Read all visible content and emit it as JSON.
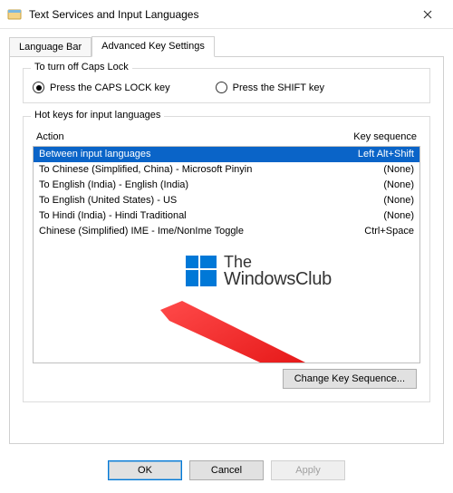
{
  "window": {
    "title": "Text Services and Input Languages"
  },
  "tabs": {
    "t0": "Language Bar",
    "t1": "Advanced Key Settings"
  },
  "capslock": {
    "group": "To turn off Caps Lock",
    "opt_caps": "Press the CAPS LOCK key",
    "opt_shift": "Press the SHIFT key"
  },
  "hotkeys": {
    "group": "Hot keys for input languages",
    "col_action": "Action",
    "col_key": "Key sequence",
    "rows": [
      {
        "action": "Between input languages",
        "key": "Left Alt+Shift"
      },
      {
        "action": "To Chinese (Simplified, China) - Microsoft Pinyin",
        "key": "(None)"
      },
      {
        "action": "To English (India) - English (India)",
        "key": "(None)"
      },
      {
        "action": "To English (United States) - US",
        "key": "(None)"
      },
      {
        "action": "To Hindi (India) - Hindi Traditional",
        "key": "(None)"
      },
      {
        "action": "Chinese (Simplified) IME - Ime/NonIme Toggle",
        "key": "Ctrl+Space"
      }
    ],
    "change_btn": "Change Key Sequence..."
  },
  "buttons": {
    "ok": "OK",
    "cancel": "Cancel",
    "apply": "Apply"
  },
  "watermark": {
    "line1": "The",
    "line2": "WindowsClub"
  }
}
